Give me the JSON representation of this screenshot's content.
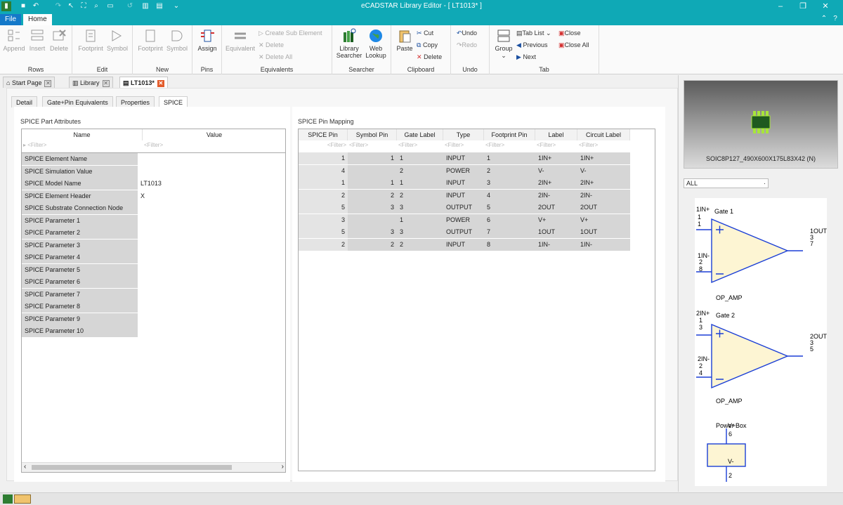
{
  "app": {
    "title": "eCADSTAR Library Editor - [ LT1013* ]"
  },
  "menu": {
    "file": "File",
    "home": "Home"
  },
  "ribbon": {
    "rows": {
      "label": "Rows",
      "append": "Append",
      "insert": "Insert",
      "delete": "Delete"
    },
    "edit": {
      "label": "Edit",
      "footprint": "Footprint",
      "symbol": "Symbol"
    },
    "new": {
      "label": "New",
      "footprint": "Footprint",
      "symbol": "Symbol"
    },
    "pins": {
      "label": "Pins",
      "assign": "Assign"
    },
    "equivalents": {
      "label": "Equivalents",
      "equivalent": "Equivalent",
      "create_sub": "Create Sub Element",
      "delete": "Delete",
      "delete_all": "Delete All"
    },
    "searcher": {
      "label": "Searcher",
      "library_searcher_1": "Library",
      "library_searcher_2": "Searcher",
      "web_lookup_1": "Web",
      "web_lookup_2": "Lookup"
    },
    "clipboard": {
      "label": "Clipboard",
      "paste": "Paste",
      "cut": "Cut",
      "copy": "Copy",
      "delete": "Delete"
    },
    "undo": {
      "label": "Undo",
      "undo": "Undo",
      "redo": "Redo"
    },
    "tab": {
      "label": "Tab",
      "group": "Group",
      "tab_list": "Tab List",
      "previous": "Previous",
      "next": "Next",
      "close": "Close",
      "close_all": "Close All"
    }
  },
  "doc_tabs": {
    "start": "Start Page",
    "library": "Library",
    "current": "LT1013*"
  },
  "sub_tabs": {
    "detail": "Detail",
    "gate_pin": "Gate+Pin Equivalents",
    "properties": "Properties",
    "spice": "SPICE"
  },
  "attributes": {
    "title": "SPICE Part Attributes",
    "headers": {
      "name": "Name",
      "value": "Value"
    },
    "filter": "<Filter>",
    "rows": [
      {
        "name": "SPICE Element Name",
        "value": ""
      },
      {
        "name": "SPICE Simulation Value",
        "value": ""
      },
      {
        "name": "SPICE Model Name",
        "value": "LT1013"
      },
      {
        "name": "SPICE Element Header",
        "value": "X"
      },
      {
        "name": "SPICE Substrate Connection Node",
        "value": ""
      },
      {
        "name": "SPICE Parameter 1",
        "value": ""
      },
      {
        "name": "SPICE Parameter 2",
        "value": ""
      },
      {
        "name": "SPICE Parameter 3",
        "value": ""
      },
      {
        "name": "SPICE Parameter 4",
        "value": ""
      },
      {
        "name": "SPICE Parameter 5",
        "value": ""
      },
      {
        "name": "SPICE Parameter 6",
        "value": ""
      },
      {
        "name": "SPICE Parameter 7",
        "value": ""
      },
      {
        "name": "SPICE Parameter 8",
        "value": ""
      },
      {
        "name": "SPICE Parameter 9",
        "value": ""
      },
      {
        "name": "SPICE Parameter 10",
        "value": ""
      }
    ]
  },
  "pin_mapping": {
    "title": "SPICE Pin Mapping",
    "headers": [
      "SPICE Pin",
      "Symbol Pin",
      "Gate Label",
      "Type",
      "Footprint Pin",
      "Label",
      "Circuit Label"
    ],
    "filter": "<Filter>",
    "rows": [
      [
        "1",
        "1",
        "1",
        "INPUT",
        "1",
        "1IN+",
        "1IN+"
      ],
      [
        "4",
        "",
        "2",
        "POWER",
        "2",
        "V-",
        "V-"
      ],
      [
        "1",
        "1",
        "1",
        "INPUT",
        "3",
        "2IN+",
        "2IN+"
      ],
      [
        "2",
        "2",
        "2",
        "INPUT",
        "4",
        "2IN-",
        "2IN-"
      ],
      [
        "5",
        "3",
        "3",
        "OUTPUT",
        "5",
        "2OUT",
        "2OUT"
      ],
      [
        "3",
        "",
        "1",
        "POWER",
        "6",
        "V+",
        "V+"
      ],
      [
        "5",
        "3",
        "3",
        "OUTPUT",
        "7",
        "1OUT",
        "1OUT"
      ],
      [
        "2",
        "2",
        "2",
        "INPUT",
        "8",
        "1IN-",
        "1IN-"
      ]
    ]
  },
  "preview": {
    "footprint_name": "SOIC8P127_490X600X175L83X42 (N)",
    "filter_select": "ALL",
    "gate1": {
      "title": "Gate 1",
      "in_plus": "1IN+",
      "in_plus_a": "1",
      "in_plus_b": "1",
      "in_minus": "1IN-",
      "in_minus_a": "2",
      "in_minus_b": "8",
      "out": "1OUT",
      "out_a": "3",
      "out_b": "7",
      "type": "OP_AMP"
    },
    "gate2": {
      "title": "Gate 2",
      "in_plus": "2IN+",
      "in_plus_a": "1",
      "in_plus_b": "3",
      "in_minus": "2IN-",
      "in_minus_a": "2",
      "in_minus_b": "4",
      "out": "2OUT",
      "out_a": "3",
      "out_b": "5",
      "type": "OP_AMP"
    },
    "power": {
      "title": "Power Box",
      "vplus": "V+",
      "vplus_pin": "6",
      "vminus": "V-",
      "vminus_pin": "2"
    }
  }
}
